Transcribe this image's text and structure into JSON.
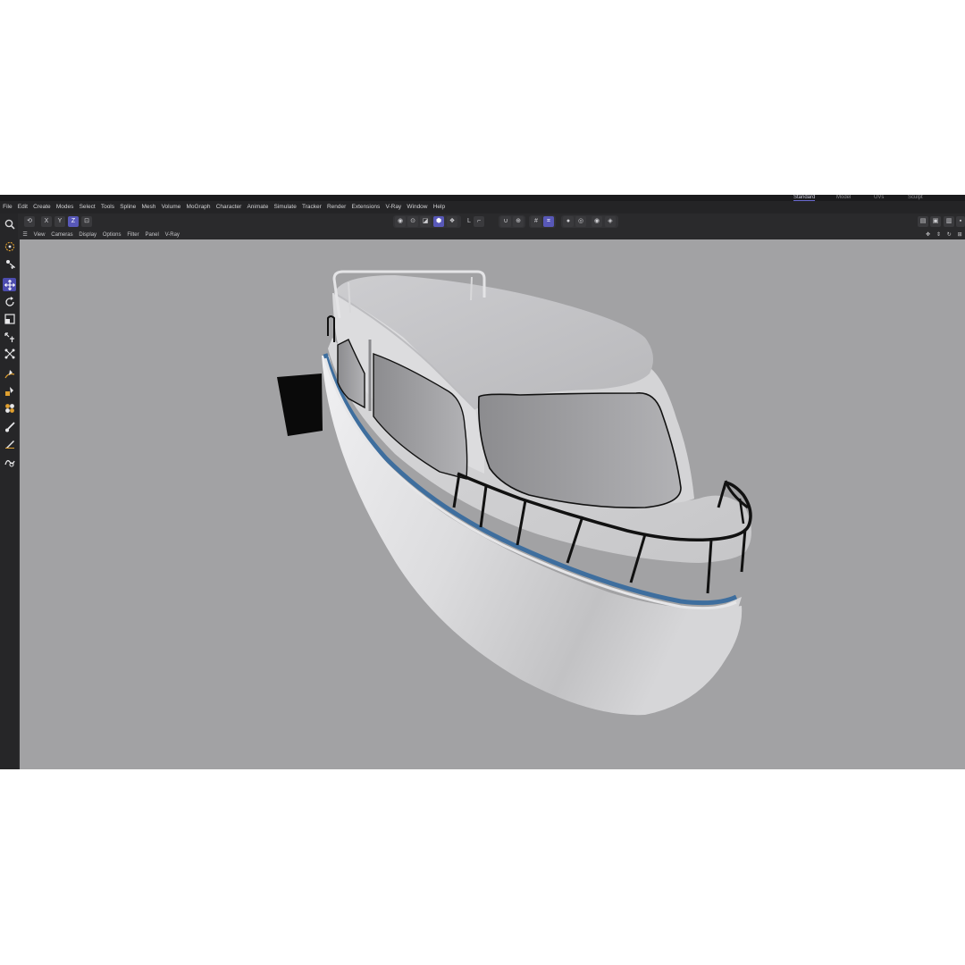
{
  "title_bar": {
    "layout_tabs": [
      "Standard",
      "Model",
      "UVs",
      "Sculpt"
    ]
  },
  "menu": {
    "items": [
      "File",
      "Edit",
      "Create",
      "Modes",
      "Select",
      "Tools",
      "Spline",
      "Mesh",
      "Volume",
      "MoGraph",
      "Character",
      "Animate",
      "Simulate",
      "Tracker",
      "Render",
      "Extensions",
      "V-Ray",
      "Window",
      "Help"
    ]
  },
  "toolbar": {
    "axis_x": "X",
    "axis_y": "Y",
    "axis_z": "Z",
    "coord_label": "L"
  },
  "viewport_menu": {
    "items": [
      "View",
      "Cameras",
      "Display",
      "Options",
      "Filter",
      "Panel",
      "V-Ray"
    ]
  },
  "left_tools": [
    "search-icon",
    "live-selection-icon",
    "select-tools-icon",
    "move-icon",
    "rotate-icon",
    "scale-icon",
    "transform-icon",
    "snap-icon",
    "spline-pen-icon",
    "fill-paint-icon",
    "shaders-icon",
    "brush-icon",
    "knife-icon",
    "sculpt-icon"
  ],
  "colors": {
    "accent": "#5858b8",
    "viewport_bg": "#a2a2a4",
    "hull_stripe": "#3e6e9e"
  }
}
